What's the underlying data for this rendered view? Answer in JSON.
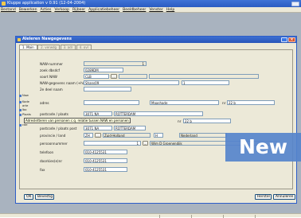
{
  "app": {
    "title": "Kluppe application v 0.91 (12-04-2004)",
    "menu": [
      "Bestand",
      "Bewerken",
      "Acties",
      "Verkoop",
      "Rijbeer",
      "Applicatiebeheer",
      "Beeldbeheer",
      "Venster",
      "Help"
    ]
  },
  "dialog": {
    "title": "Aleleren Nawgegevens",
    "tabs": [
      "1. Main",
      "2. verwdg",
      "3. adr",
      "4. ovl"
    ],
    "labels": {
      "nawnummer": "NAW-nummer",
      "zoek_dbsdcf": "zoek dbsdcf",
      "soort_naw": "soort NAW",
      "naw_naam": "NAW-gegevens naam (+hand cde)",
      "ze_deel_naam": "2e deel naam",
      "adres": "adres",
      "nr": "nr",
      "postcode_plaats": "postcode / plaats",
      "postcode_plaats_post": "postcode / plaats post",
      "provincie_land": "provincie / land",
      "persoonnummer": "persoonnummer",
      "telefoon": "telefoon",
      "doorkiesnr": "doorkies(e)nr",
      "fax": "fax",
      "side_naw": "Naw",
      "side_kode": "Kode",
      "side_arte": "arte",
      "side_lbo": "lbo",
      "side_plaats": "Plaats",
      "side_cde": "cde"
    },
    "values": {
      "nawnummer": "1",
      "zoek_dbsdcf": "0289DM",
      "soort_naw": "CLB",
      "soort_btn": "...",
      "naw_naam": "Shans09",
      "naw_naam_extra": "1",
      "adres_straat": "Maashade",
      "nr": "22 b",
      "postcode": "3071 NA",
      "plaats": "ROTTERDAM",
      "hint_text": "Adresletteren van personen c.q. relatie tussen NAW en personen",
      "nr2": "22 b",
      "postcode_post": "3071 NA",
      "plaats_post": "ROTTERDAM",
      "provincie_code": "ZH",
      "provincie_btn": "...",
      "provincie": "Zuid-Holland",
      "land_code": "H",
      "land": "Nederland",
      "persoonnummer": "1",
      "persoon_naam": "Wim D Groenendijk",
      "telefoon": "010-4125531",
      "doorkiesnr": "010-4125531",
      "fax": "010-4125531"
    },
    "buttons": {
      "ok": "OK",
      "bevestig": "Bevestig",
      "herstel": "Herstel",
      "annuleren": "Annuleren"
    }
  },
  "banner": "New",
  "colors": {
    "titlebar": "#2b5cc2",
    "dialog_bg": "#ece9d8",
    "mdi_bg": "#a9b3bf",
    "banner": "#5684cc"
  }
}
